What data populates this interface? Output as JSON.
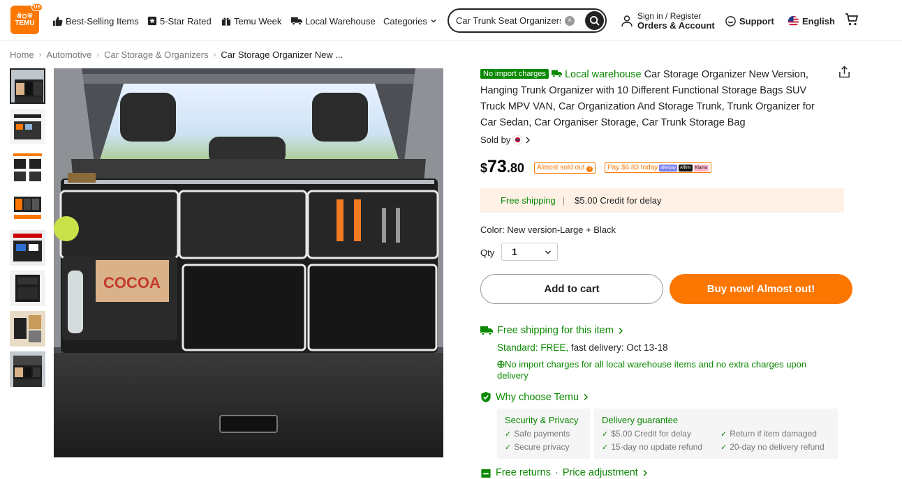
{
  "header": {
    "logo": {
      "text": "TEMU",
      "badge": "US",
      "top_text": "ऄ⛭⛨"
    },
    "nav": [
      {
        "label": "Best-Selling Items",
        "icon": "thumbs-up-icon"
      },
      {
        "label": "5-Star Rated",
        "icon": "star-badge-icon"
      },
      {
        "label": "Temu Week",
        "icon": "gift-icon"
      },
      {
        "label": "Local Warehouse",
        "icon": "truck-icon"
      },
      {
        "label": "Categories",
        "icon": "chevron-down-icon"
      }
    ],
    "search": {
      "value": "Car Trunk Seat Organizers",
      "placeholder": ""
    },
    "account": {
      "line1": "Sign in / Register",
      "line2": "Orders & Account"
    },
    "support": "Support",
    "language": "English"
  },
  "breadcrumb": [
    "Home",
    "Automotive",
    "Car Storage & Organizers",
    "Car Storage Organizer New ..."
  ],
  "gallery": {
    "thumb_count": 8,
    "active_index": 7
  },
  "product": {
    "badge_no_import": "No import charges",
    "local_warehouse": "Local warehouse",
    "title": "Car Storage Organizer New Version, Hanging Trunk Organizer with 10 Different Functional Storage Bags SUV Truck MPV VAN, Car Organization And Storage Trunk, Trunk Organizer for Car Sedan, Car Organiser Storage, Car Trunk Storage Bag",
    "sold_by": "Sold by",
    "price": {
      "currency": "$",
      "integer": "73",
      "decimal": ".80"
    },
    "almost_sold_out": "Almost sold out",
    "pay_later": "Pay $6.83 today",
    "pay_logos": [
      "afterpay",
      "Affirm",
      "Klarna"
    ],
    "shipping_banner": {
      "free": "Free shipping",
      "credit": "$5.00 Credit for delay"
    },
    "color": {
      "label": "Color:",
      "value": "New version-Large + Black"
    },
    "qty": {
      "label": "Qty",
      "value": "1"
    },
    "add_to_cart": "Add to cart",
    "buy_now": "Buy now! Almost out!"
  },
  "shipping": {
    "title": "Free shipping for this item",
    "standard_label": "Standard:",
    "standard_value": "FREE,",
    "delivery": "fast delivery: Oct 13-18",
    "no_import": "No import charges for all local warehouse items and no extra charges upon delivery"
  },
  "why": {
    "title": "Why choose Temu",
    "security": {
      "heading": "Security & Privacy",
      "items": [
        "Safe payments",
        "Secure privacy"
      ]
    },
    "delivery": {
      "heading": "Delivery guarantee",
      "items": [
        "$5.00 Credit for delay",
        "15-day no update refund",
        "Return if item damaged",
        "20-day no delivery refund"
      ]
    }
  },
  "returns": {
    "label1": "Free returns",
    "dot": "·",
    "label2": "Price adjustment"
  },
  "colors": {
    "accent": "#fb7701",
    "green": "#0a8800",
    "banner": "#fff1e6"
  }
}
